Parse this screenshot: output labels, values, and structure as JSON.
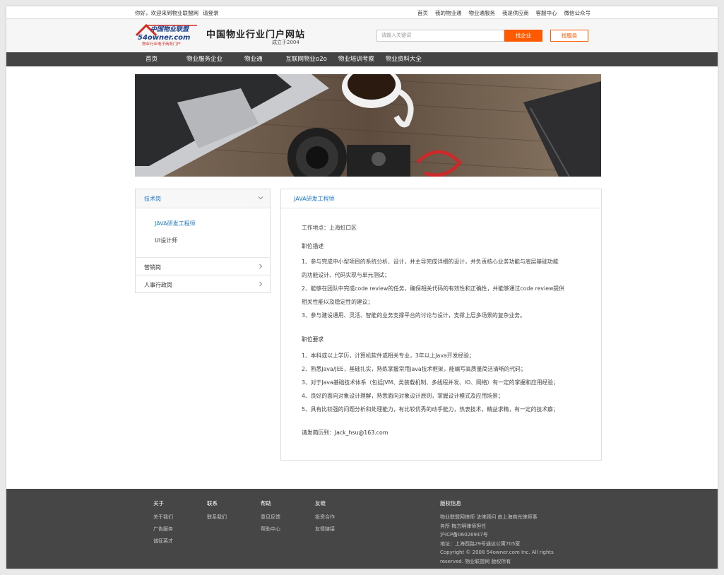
{
  "topbar": {
    "greeting": "你好，欢迎来到物业联盟网",
    "login": "请登录",
    "links": [
      "首页",
      "我的物业通",
      "物业通服务",
      "我是供应商",
      "客服中心",
      "微信公众号"
    ]
  },
  "header": {
    "logo_text": "中国物业联盟",
    "logo_domain": "54owner.com",
    "logo_tag": "物业行业电子商务门户",
    "slogan": "中国物业行业门户网站",
    "since": "成立于2004",
    "search_placeholder": "请输入关键词",
    "search_button": "找企业",
    "service_button": "找服务"
  },
  "nav": [
    "首页",
    "物业服务企业",
    "物业通",
    "互联网物业o2o",
    "物业培训考察",
    "物业资料大全"
  ],
  "sidebar": {
    "categories": [
      {
        "label": "技术岗",
        "subitems": [
          "JAVA研发工程师",
          "UI设计师"
        ]
      },
      {
        "label": "营销岗"
      },
      {
        "label": "人事行政岗"
      }
    ]
  },
  "content": {
    "title": "JAVA研发工程师",
    "location": "工作地点：上海虹口区",
    "desc_title": "职位描述",
    "desc_lines": [
      "1、参与完成中小型项目的系统分析、设计，并主导完成详细的设计，并负责核心业务功能与底层基础功能",
      "的功能设计、代码实现与单元测试；",
      "2、能够在团队中完成code review的任务，确保相关代码的有效性和正确性，并能够通过code review提供",
      "相关性能以及稳定性的建议；",
      "3、参与建设通用、灵活、智能的业务支撑平台的讨论与设计，支撑上层多场景的复杂业务。"
    ],
    "req_title": "职位要求",
    "req_lines": [
      "1、本科或以上学历，计算机软件或相关专业，3年以上Java开发经验；",
      "2、熟悉Java/JEE，基础扎实，熟练掌握常用Java技术框架，能编写高质量简洁清晰的代码；",
      "3、对于Java基础技术体系（包括JVM、类装载机制、多线程并发、IO、网络）有一定的掌握和应用经验；",
      "4、良好的面向对象设计理解，熟悉面向对象设计原则，掌握设计模式及应用场景；",
      "5、具有比较强的问题分析和处理能力，有比较优秀的动手能力，热衷技术，精益求精，有一定的技术癖；"
    ],
    "resume": "请发简历到：Jack_hsu@163.com"
  },
  "footer": {
    "columns": [
      {
        "title": "关于",
        "items": [
          "关于我们",
          "广告服务",
          "诚征英才"
        ]
      },
      {
        "title": "联系",
        "items": [
          "联系我们"
        ]
      },
      {
        "title": "帮助",
        "items": [
          "意见反馈",
          "帮助中心"
        ]
      },
      {
        "title": "友链",
        "items": [
          "投资合作",
          "友情链接"
        ]
      }
    ],
    "copyright_title": "版权信息",
    "copyright_lines": [
      "物业联盟网律师 法律顾问 由上海商光律师事",
      "务所 梅方明律师担任",
      "沪ICP备06026947号",
      "地址：上海西路29号通达公寓705室",
      "Copyright © 2008 54owner.com Inc. All rights",
      "reserved. 物业联盟网 版权所有"
    ]
  },
  "colors": {
    "accent": "#ff5a00",
    "link_blue": "#1f7acb",
    "nav_bg": "#444444",
    "footer_bg": "#464646"
  }
}
